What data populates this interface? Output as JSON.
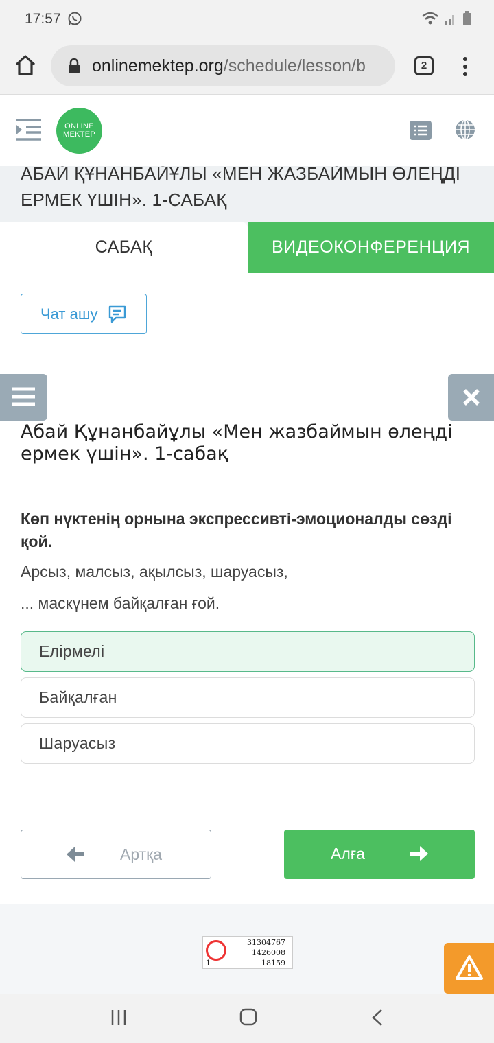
{
  "status_bar": {
    "time": "17:57"
  },
  "browser": {
    "url_host": "onlinemektep.org",
    "url_path": "/schedule/lesson/b",
    "tab_count": "2"
  },
  "header": {
    "logo_line1": "ONLINE",
    "logo_line2": "MEKTEP"
  },
  "lesson_band": {
    "title": "АБАЙ ҚҰНАНБАЙҰЛЫ «МЕН ЖАЗБАЙМЫН ӨЛЕҢДІ ЕРМЕК ҮШІН». 1-САБАҚ"
  },
  "tabs": [
    {
      "label": "САБАҚ",
      "active": true
    },
    {
      "label": "ВИДЕОКОНФЕРЕНЦИЯ",
      "active": false
    }
  ],
  "chat_button": {
    "label": "Чат ашу"
  },
  "lesson": {
    "title": "Абай Құнанбайұлы «Мен жазбаймын өлеңді ермек үшін». 1-сабақ",
    "question": "Көп нүктенің орнына экспрессивті-эмоционалды сөзді қой.",
    "poem_line1": "Арсыз, малсыз, ақылсыз, шаруасыз,",
    "poem_line2": "... маскүнем байқалған ғой."
  },
  "options": [
    {
      "label": "Елірмелі",
      "selected": true
    },
    {
      "label": "Байқалған",
      "selected": false
    },
    {
      "label": "Шаруасыз",
      "selected": false
    }
  ],
  "nav_buttons": {
    "back_label": "Артқа",
    "next_label": "Алға"
  },
  "counter": {
    "line1": "31304767",
    "line2": "1426008",
    "line3": "18159",
    "line4": "1"
  },
  "colors": {
    "accent_green": "#4cbf60",
    "chat_blue": "#3a9ad5",
    "warning_orange": "#f39a2b",
    "side_button_grey": "#9aaab5"
  }
}
